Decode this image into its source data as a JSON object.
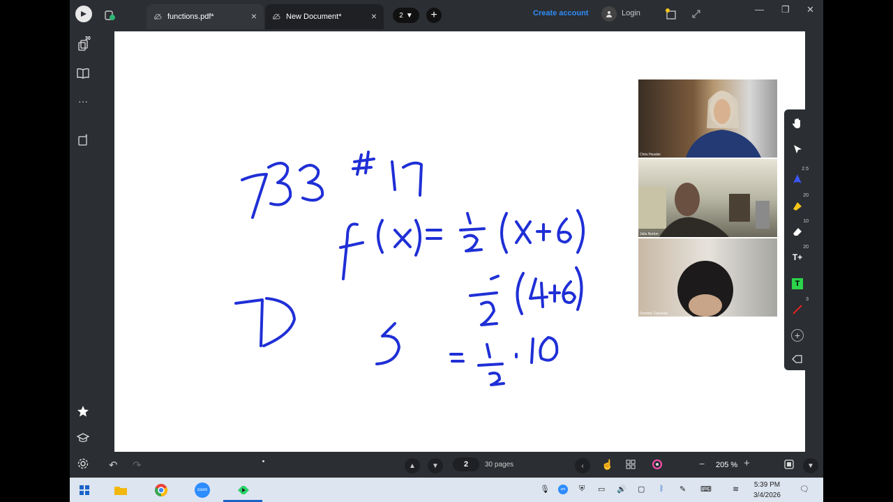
{
  "titlebar": {
    "tabs": [
      {
        "label": "functions.pdf*"
      },
      {
        "label": "New Document*"
      }
    ],
    "tab_count": "2",
    "create_account": "Create account",
    "login": "Login"
  },
  "sidebar": {
    "pages_badge": "30"
  },
  "videos": [
    {
      "name": "Chris Hessler"
    },
    {
      "name": "Julia Norton"
    },
    {
      "name": "Dominic Carranza"
    }
  ],
  "tools": {
    "pen_size": "2.5",
    "highlighter_size": "20",
    "eraser_size": "10",
    "text_size": "20",
    "line_size": "3"
  },
  "bottombar": {
    "current_page": "2",
    "total_pages": "30 pages",
    "zoom": "205 %"
  },
  "taskbar": {
    "time": "5:39 PM",
    "date": "3/4/2026",
    "zoom_app": "zoom"
  },
  "colors": {
    "ink": "#1f2fd6",
    "accent": "#2f8cf5",
    "app_bg": "#2b2e33"
  }
}
